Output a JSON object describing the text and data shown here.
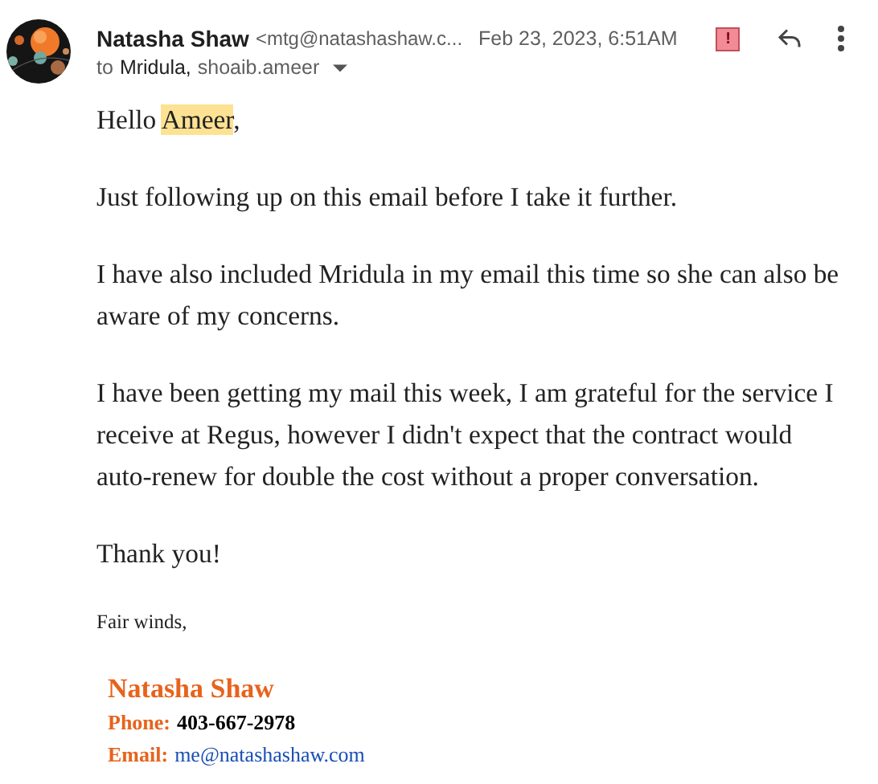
{
  "header": {
    "sender_name": "Natasha Shaw",
    "sender_email": "<mtg@natashashaw.c...",
    "date": "Feb 23, 2023, 6:51AM",
    "important_mark": "!",
    "recipients_prefix": "to",
    "recipients": [
      {
        "name": "Mridula,",
        "bold": true
      },
      {
        "name": "shoaib.ameer",
        "bold": false
      }
    ]
  },
  "greeting": {
    "before": "Hello ",
    "highlight": "Ameer",
    "after": ","
  },
  "paragraphs": [
    "Just following up on this email before I take it further.",
    "I have also included Mridula in my email this time so she can also be aware of my concerns.",
    "I have been getting my mail this week, I am grateful for the service I receive at Regus, however I didn't expect that the contract would auto-renew for double the cost without a proper conversation.",
    "Thank you!"
  ],
  "closing": "Fair winds,",
  "signature": {
    "name": "Natasha Shaw",
    "lines": [
      {
        "label": "Phone:",
        "value": "403-667-2978",
        "kind": "text"
      },
      {
        "label": "Email:",
        "value": "me@natashashaw.com",
        "kind": "link"
      }
    ]
  }
}
